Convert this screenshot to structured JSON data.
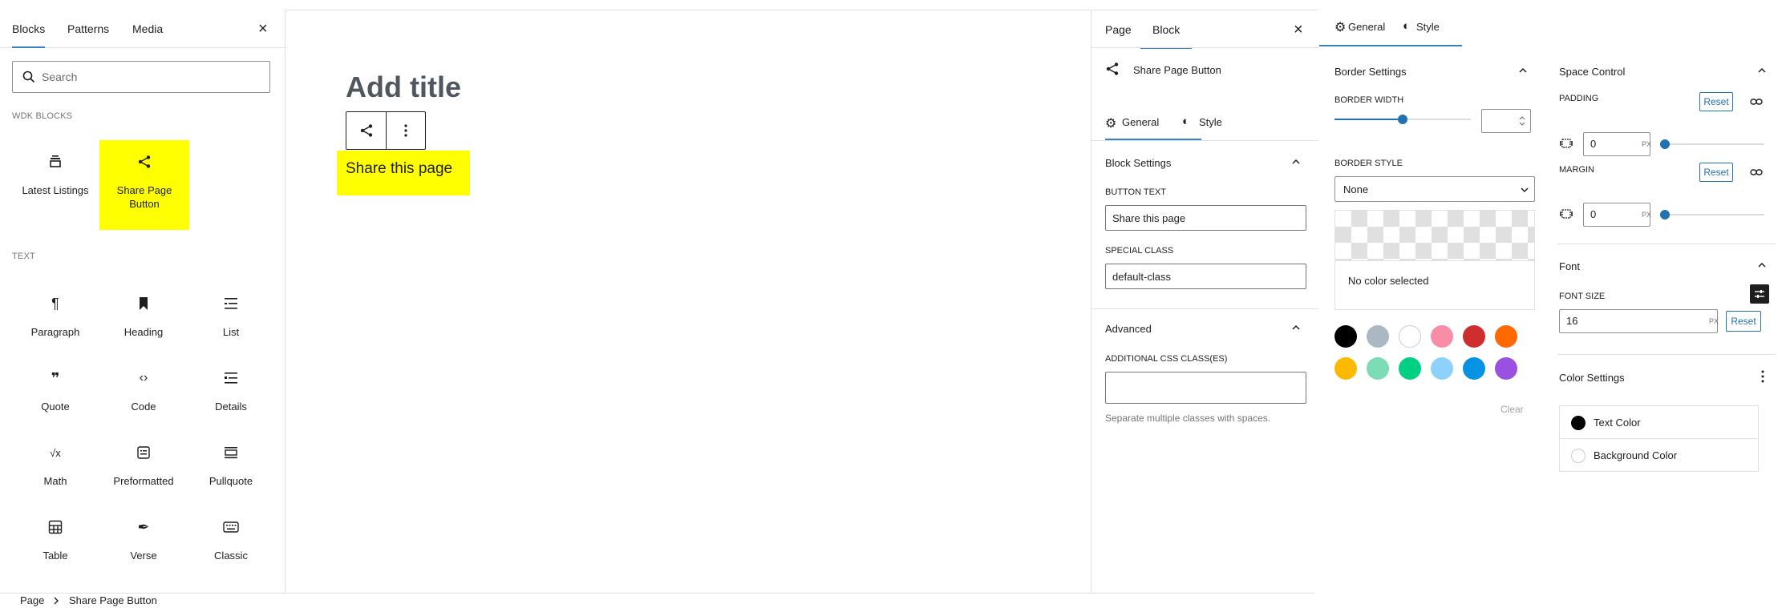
{
  "inserter": {
    "tabs": [
      "Blocks",
      "Patterns",
      "Media"
    ],
    "search_placeholder": "Search",
    "section_wdk": "WDK BLOCKS",
    "section_text": "TEXT",
    "wdk_blocks": [
      {
        "label": "Latest Listings",
        "icon": "latest-listings-icon"
      },
      {
        "label": "Share Page Button",
        "icon": "share-icon"
      }
    ],
    "text_blocks": [
      {
        "label": "Paragraph",
        "icon": "paragraph-icon",
        "glyph": "¶"
      },
      {
        "label": "Heading",
        "icon": "heading-icon",
        "glyph": "🔖"
      },
      {
        "label": "List",
        "icon": "list-icon",
        "glyph": "☰"
      },
      {
        "label": "Quote",
        "icon": "quote-icon",
        "glyph": "❞"
      },
      {
        "label": "Code",
        "icon": "code-icon",
        "glyph": "‹›"
      },
      {
        "label": "Details",
        "icon": "details-icon",
        "glyph": "☰"
      },
      {
        "label": "Math",
        "icon": "math-icon",
        "glyph": "√x"
      },
      {
        "label": "Preformatted",
        "icon": "preformatted-icon",
        "glyph": "⊡"
      },
      {
        "label": "Pullquote",
        "icon": "pullquote-icon",
        "glyph": "▭"
      },
      {
        "label": "Table",
        "icon": "table-icon",
        "glyph": "▦"
      },
      {
        "label": "Verse",
        "icon": "verse-icon",
        "glyph": "✒"
      },
      {
        "label": "Classic",
        "icon": "classic-icon",
        "glyph": "⌨"
      }
    ]
  },
  "canvas": {
    "title_placeholder": "Add title",
    "button_text": "Share this page",
    "button_bg": "#ffff00"
  },
  "settings": {
    "tabs": [
      "Page",
      "Block"
    ],
    "block_name": "Share Page Button",
    "sub_tabs": [
      "General",
      "Style"
    ],
    "block_settings_title": "Block Settings",
    "button_text_label": "BUTTON TEXT",
    "button_text_value": "Share this page",
    "special_class_label": "SPECIAL CLASS",
    "special_class_value": "default-class",
    "advanced_title": "Advanced",
    "additional_css_label": "ADDITIONAL CSS CLASS(ES)",
    "additional_css_value": "",
    "additional_css_help": "Separate multiple classes with spaces."
  },
  "style": {
    "tabs": [
      "General",
      "Style"
    ],
    "border_settings_title": "Border Settings",
    "border_width_label": "BORDER WIDTH",
    "border_width_level": 0.5,
    "border_style_label": "BORDER STYLE",
    "border_style_value": "None",
    "no_color_text": "No color selected",
    "clear_label": "Clear",
    "swatches": [
      "#000000",
      "#abb8c3",
      "#ffffff",
      "#f78da7",
      "#cf2e2e",
      "#ff6900",
      "#fcb900",
      "#7bdcb5",
      "#00d084",
      "#8ed1fc",
      "#0693e3",
      "#9b51e0"
    ],
    "space_control_title": "Space Control",
    "padding_label": "PADDING",
    "padding_value": "0",
    "margin_label": "MARGIN",
    "margin_value": "0",
    "unit_px": "PX",
    "reset_label": "Reset",
    "font_title": "Font",
    "font_size_label": "FONT SIZE",
    "font_size_value": "16",
    "color_settings_title": "Color Settings",
    "text_color_label": "Text Color",
    "text_color": "#000000",
    "bg_color_label": "Background Color",
    "bg_color": "#ffffff"
  },
  "breadcrumb": {
    "items": [
      "Page",
      "Share Page Button"
    ]
  },
  "colors": {
    "accent": "#3582c4",
    "highlight": "#ffff00"
  }
}
